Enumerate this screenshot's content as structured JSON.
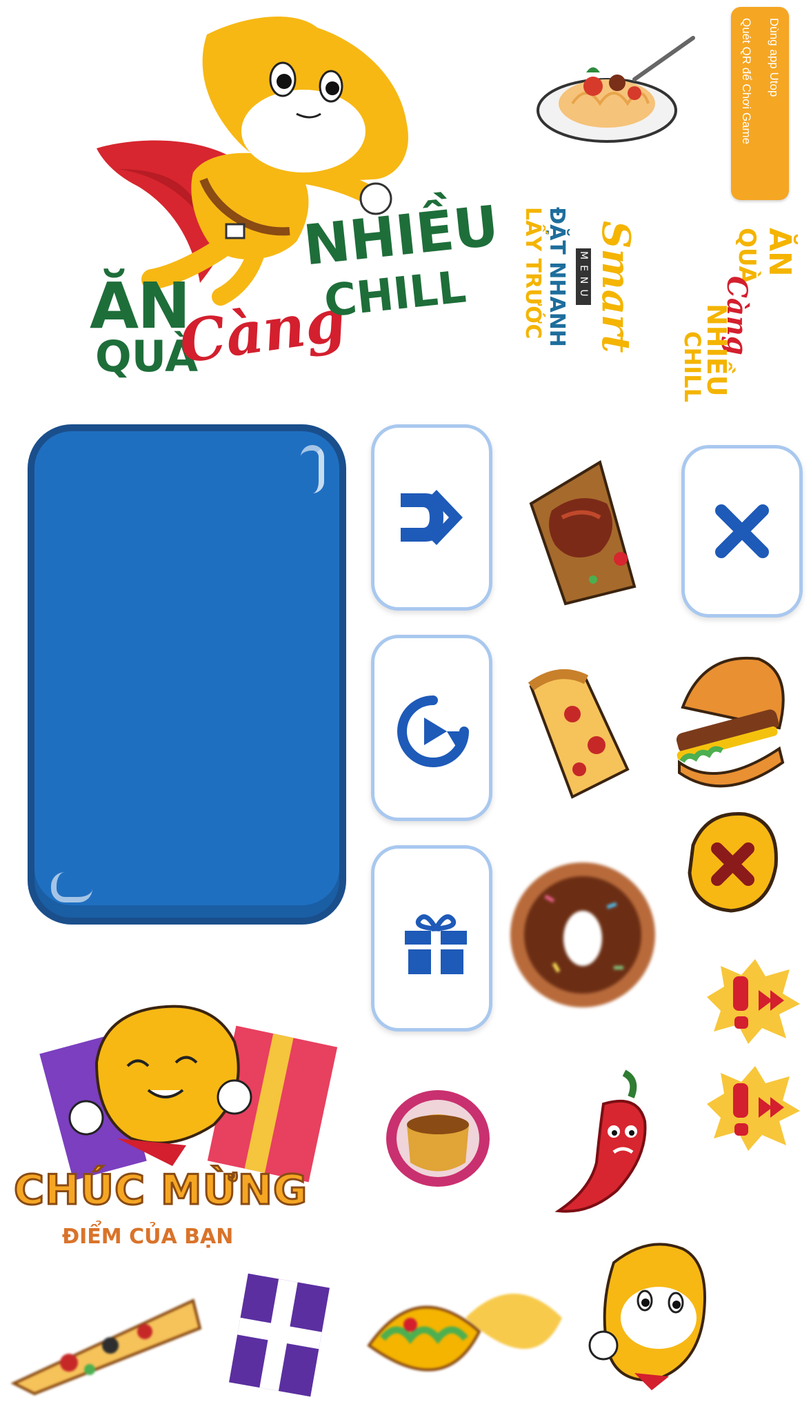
{
  "logo_main": {
    "line1": "ĂN",
    "line2": "QUÀ",
    "accent": "Càng",
    "right1": "NHIỀU",
    "right2": "CHILL",
    "colors": {
      "green": "#1e6e3a",
      "red": "#d31f2e",
      "yellow": "#f4b400"
    }
  },
  "logo_small": {
    "line1": "ĂN",
    "line2": "QUÀ",
    "accent": "Càng",
    "right1": "NHIỀU",
    "right2": "CHILL"
  },
  "smart_menu": {
    "script": "Smart",
    "tag": "MENU",
    "line1": "ĐẶT NHANH",
    "line2": "LẤY TRƯỚC"
  },
  "promo_tag": {
    "line1": "Dùng app Utop",
    "line2": "Quét QR để Chơi Game"
  },
  "congrats": {
    "title": "CHÚC MỪNG",
    "subtitle": "ĐIỂM CỦA BẠN"
  },
  "buttons": {
    "next": "next-icon",
    "close": "close-icon",
    "replay": "replay-icon",
    "gift": "gift-icon",
    "wrong": "wrong-icon"
  },
  "food_items": [
    "spaghetti",
    "steak",
    "pizza-slice",
    "burger",
    "donut",
    "flan",
    "chili-pepper",
    "pizza",
    "taco",
    "gift-box"
  ],
  "colors": {
    "panel_blue": "#1f6fc1",
    "panel_border": "#1a4f8c",
    "button_blue": "#1e5ab8",
    "orange": "#f5a623",
    "mascot_yellow": "#f7b814"
  }
}
